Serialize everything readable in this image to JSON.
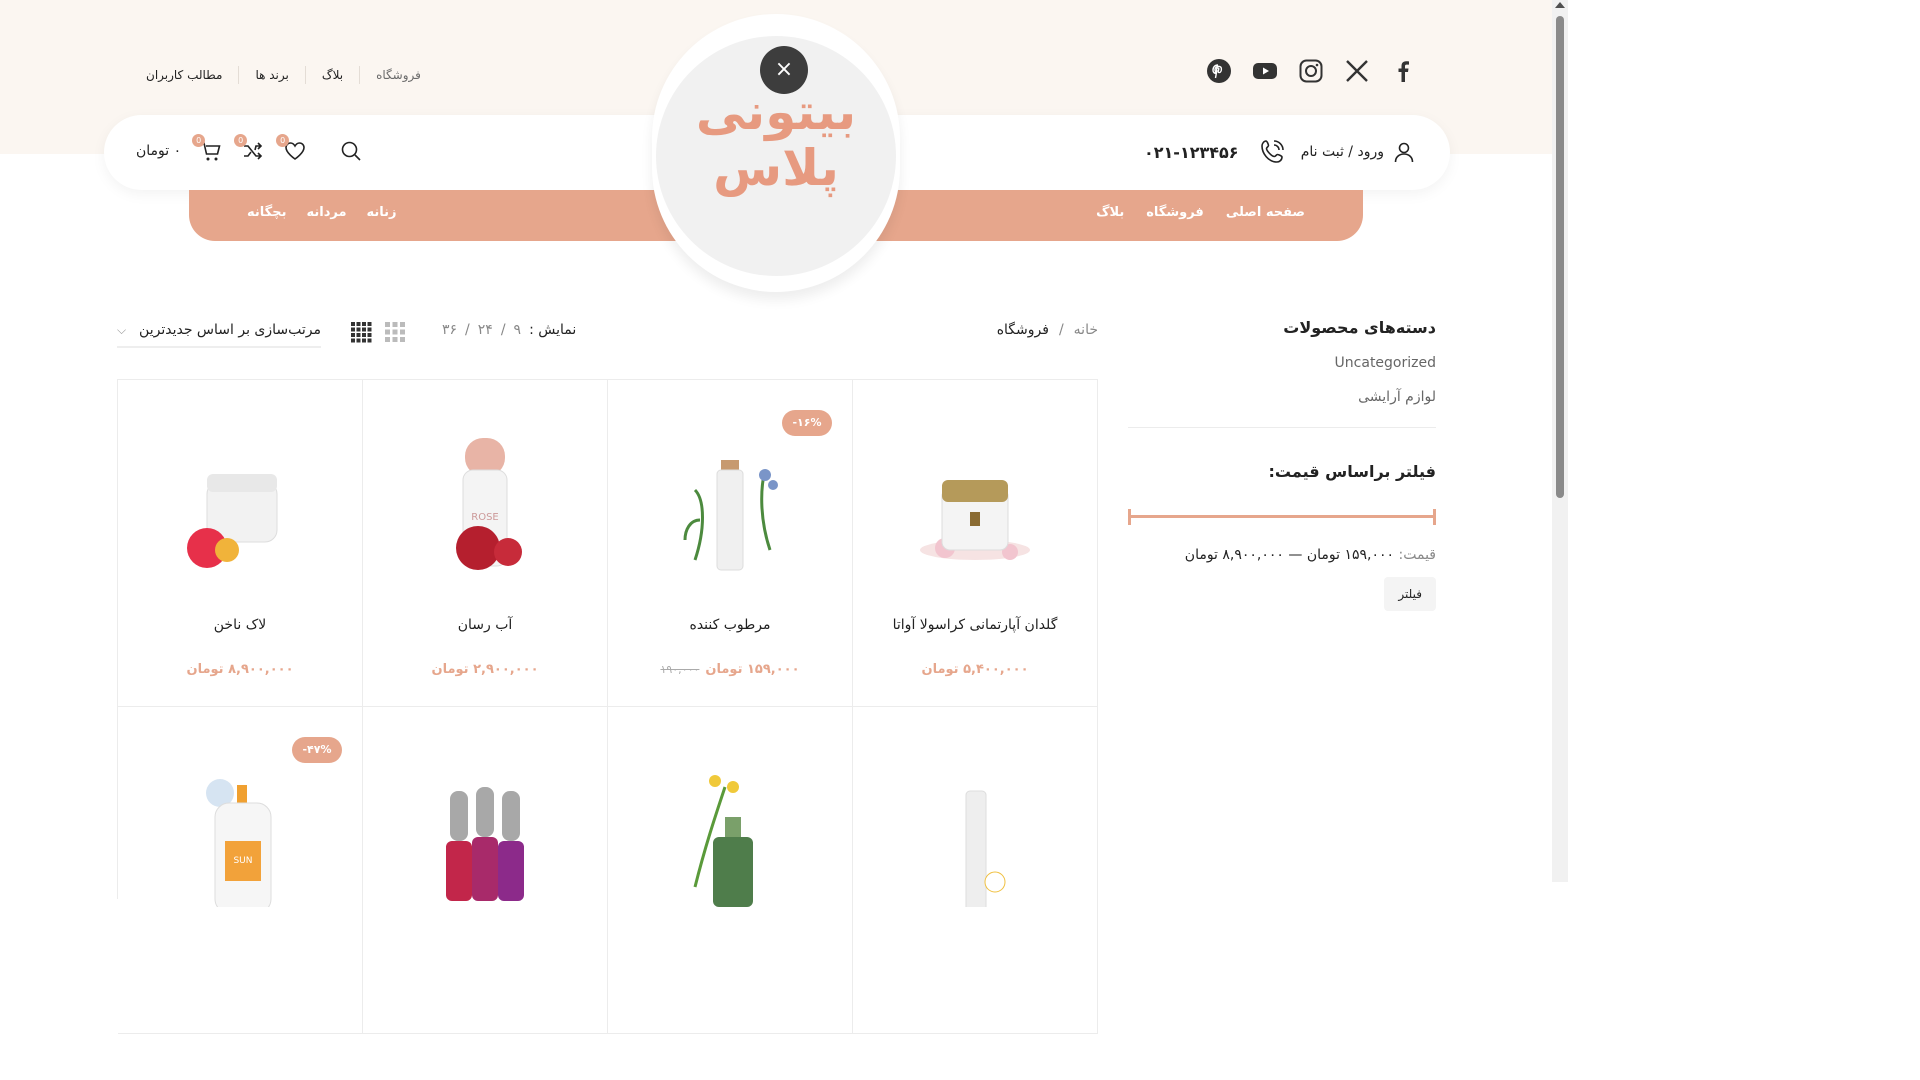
{
  "top_links": [
    "فروشگاه",
    "بلاگ",
    "برند ها",
    "مطالب کاربران"
  ],
  "social": [
    "pinterest-icon",
    "youtube-icon",
    "instagram-icon",
    "x-icon",
    "facebook-icon"
  ],
  "logo": {
    "line1": "بیتونی",
    "line2": "پلاس",
    "close": "×"
  },
  "header": {
    "login_label": "ورود / ثبت نام",
    "phone": "۰۲۱-۱۲۳۴۵۶",
    "cart_amount": "۰ تومان",
    "wishlist_count": "0",
    "compare_count": "0",
    "cart_count": "0"
  },
  "nav_right": [
    "صفحه اصلی",
    "فروشگاه",
    "بلاگ"
  ],
  "nav_left": [
    "زنانه",
    "مردانه",
    "بچگانه"
  ],
  "breadcrumb": {
    "home": "خانه",
    "sep": "/",
    "current": "فروشگاه"
  },
  "show_per_page": {
    "label": "نمایش :",
    "options": [
      "۹",
      "۲۴",
      "۳۶"
    ],
    "sep": "/"
  },
  "sort": {
    "value": "مرتب‌سازی بر اساس جدیدترین"
  },
  "products": [
    {
      "name": "گلدان آپارتمانی کراسولا آواتا",
      "price": "۵,۴۰۰,۰۰۰ تومان",
      "old_price": "",
      "badge": ""
    },
    {
      "name": "مرطوب کننده",
      "price": "۱۵۹,۰۰۰ تومان",
      "old_price": "۱۹۰,۰۰۰",
      "badge": "-۱۶%"
    },
    {
      "name": "آب رسان",
      "price": "۲,۹۰۰,۰۰۰ تومان",
      "old_price": "",
      "badge": ""
    },
    {
      "name": "لاک ناخن",
      "price": "۸,۹۰۰,۰۰۰ تومان",
      "old_price": "",
      "badge": ""
    },
    {
      "name": "",
      "price": "",
      "old_price": "",
      "badge": ""
    },
    {
      "name": "",
      "price": "",
      "old_price": "",
      "badge": ""
    },
    {
      "name": "",
      "price": "",
      "old_price": "",
      "badge": ""
    },
    {
      "name": "",
      "price": "",
      "old_price": "",
      "badge": "-۴۷%"
    }
  ],
  "sidebar": {
    "categories_title": "دسته‌های محصولات",
    "categories": [
      "Uncategorized",
      "لوازم آرایشی"
    ],
    "filter_title": "فیلتر براساس قیمت:",
    "price_label": "قیمت:",
    "price_range": "۱۵۹,۰۰۰ تومان — ۸,۹۰۰,۰۰۰ تومان",
    "filter_button": "فیلتر"
  },
  "colors": {
    "accent": "#e6a68c",
    "band": "#fbf6f1"
  }
}
